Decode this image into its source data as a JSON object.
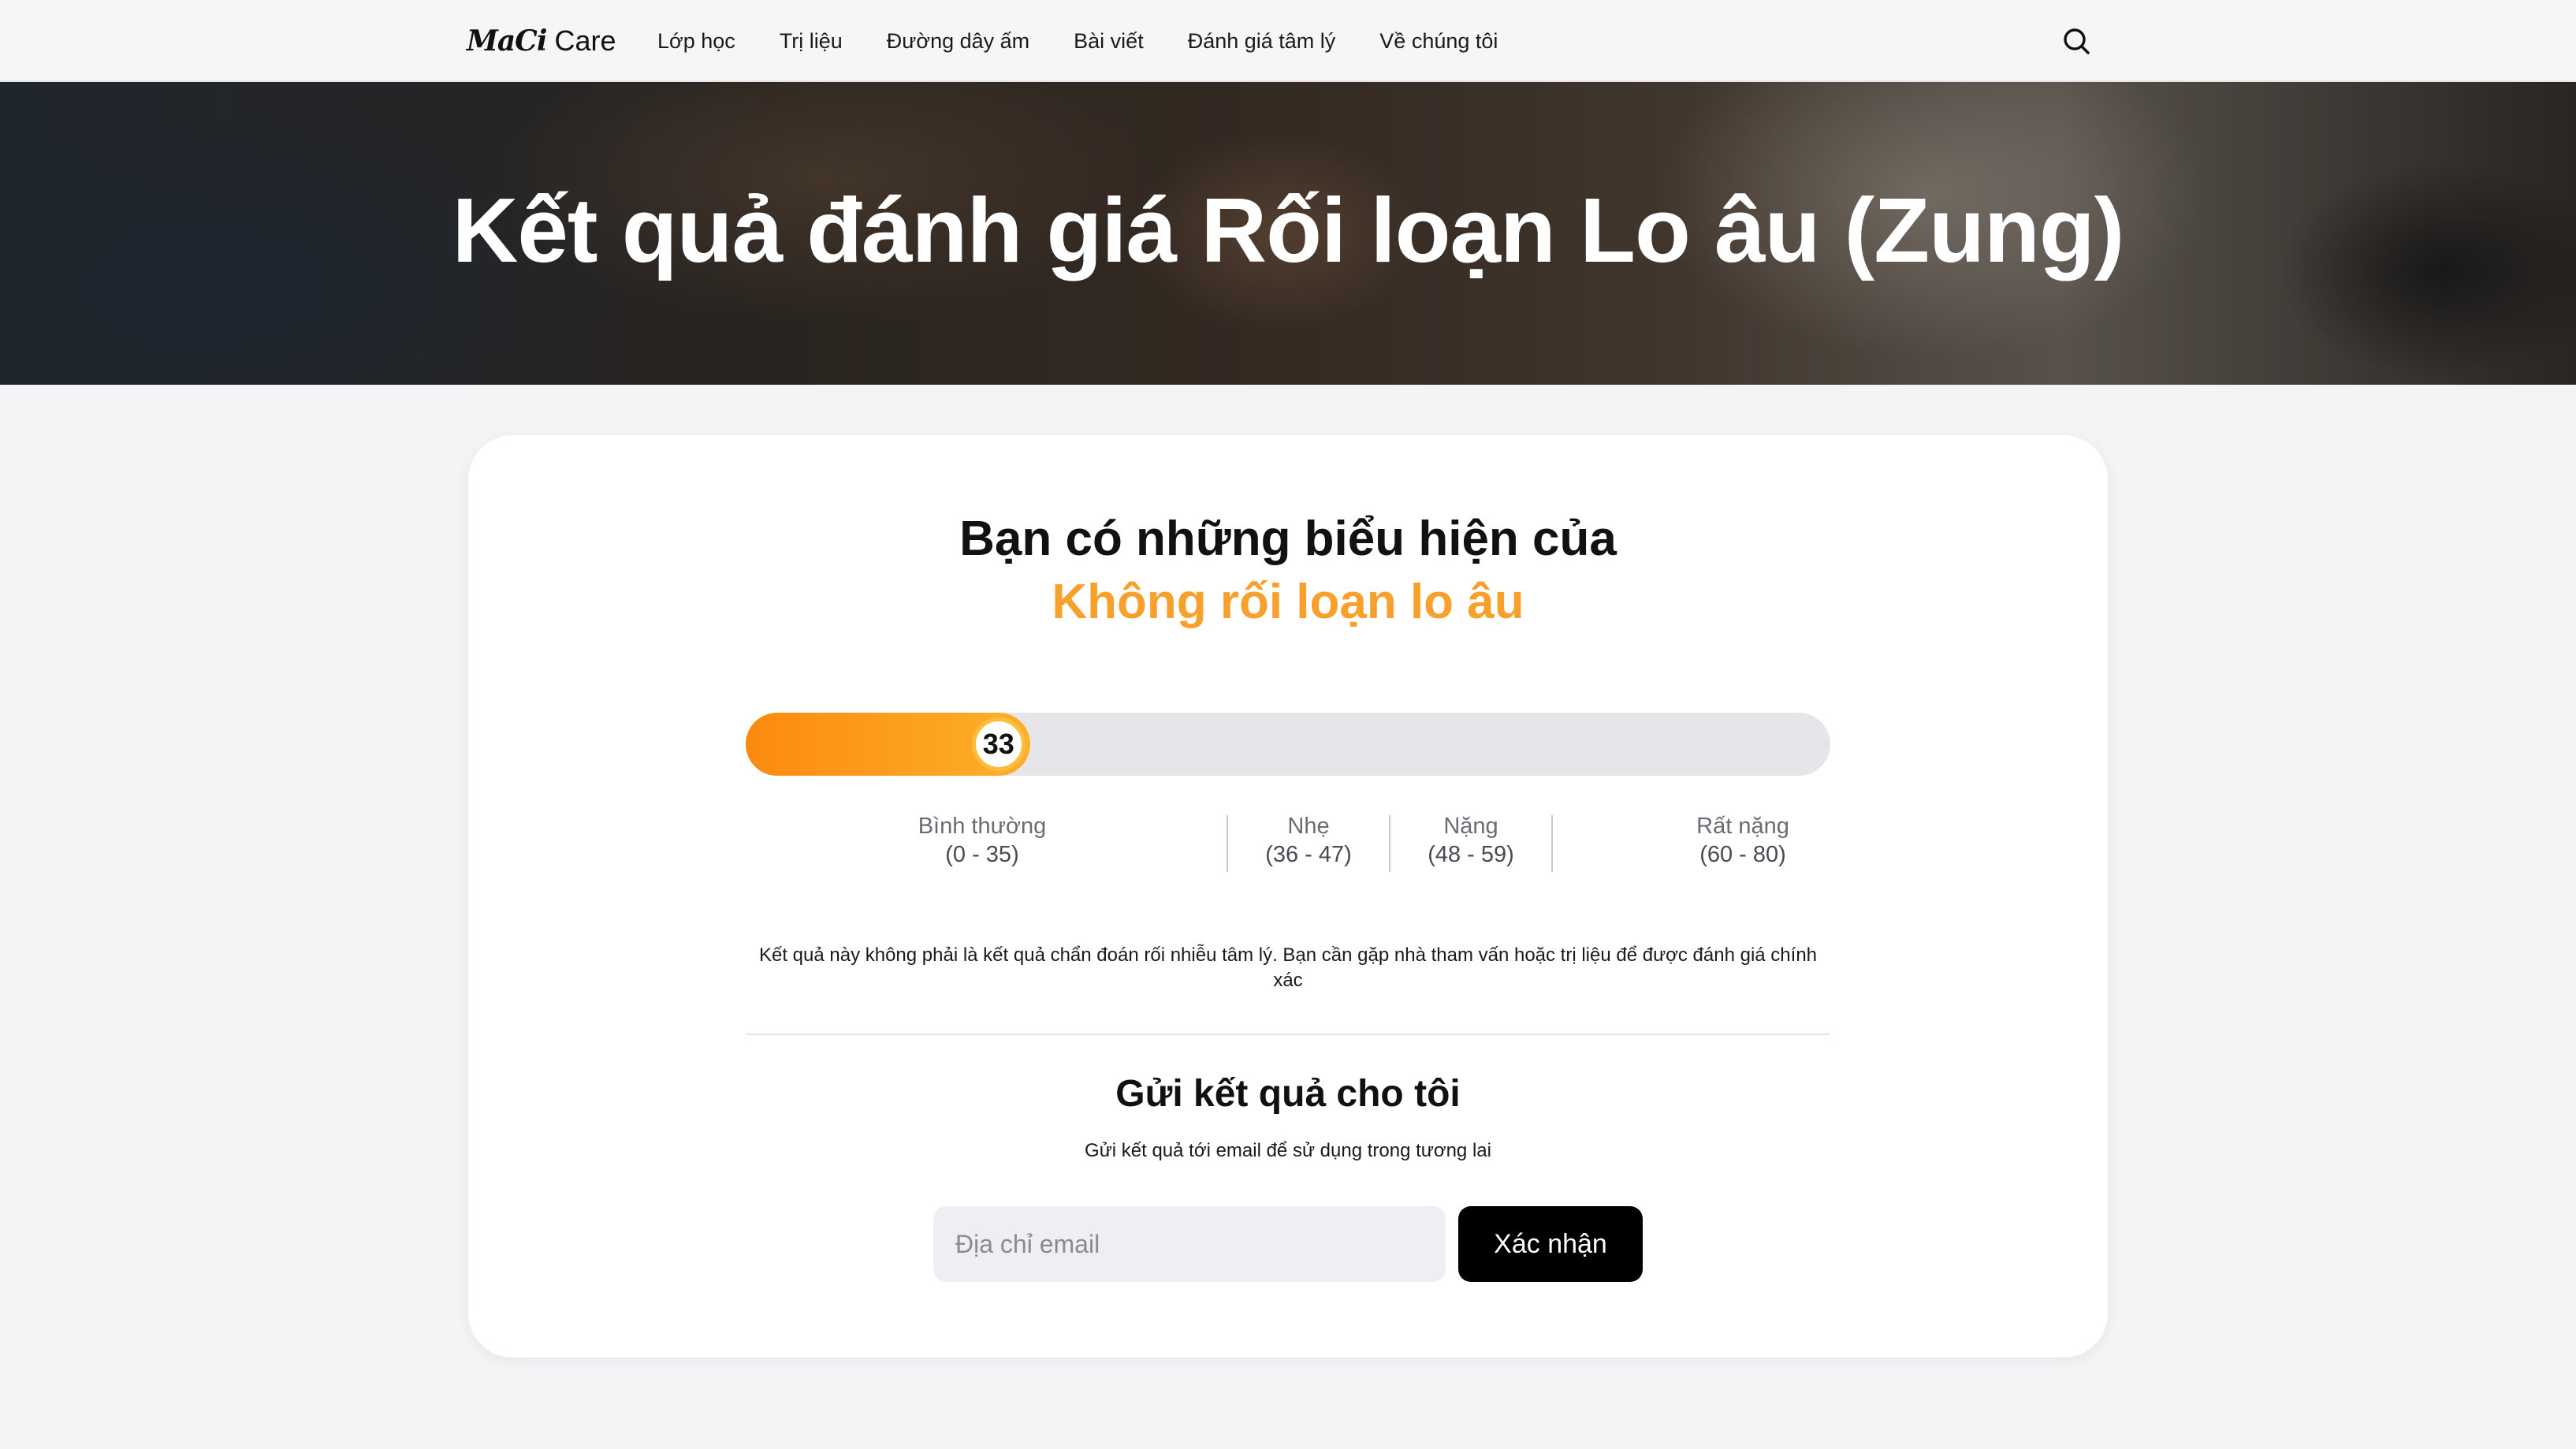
{
  "header": {
    "logo_mark": "MaCi",
    "logo_word": "Care",
    "nav": [
      {
        "label": "Lớp học"
      },
      {
        "label": "Trị liệu"
      },
      {
        "label": "Đường dây ấm"
      },
      {
        "label": "Bài viết"
      },
      {
        "label": "Đánh giá tâm lý"
      },
      {
        "label": "Về chúng tôi"
      }
    ],
    "search_icon": "search-icon"
  },
  "hero": {
    "title": "Kết quả đánh giá Rối loạn Lo âu (Zung)"
  },
  "result": {
    "heading": "Bạn có những biểu hiện của",
    "value": "Không rối loạn lo âu",
    "score": "33",
    "scale_min": 20,
    "scale_max": 80,
    "levels": [
      {
        "name": "Bình thường",
        "range": "(0 - 35)"
      },
      {
        "name": "Nhẹ",
        "range": "(36 - 47)"
      },
      {
        "name": "Nặng",
        "range": "(48 - 59)"
      },
      {
        "name": "Rất nặng",
        "range": "(60 - 80)"
      }
    ],
    "disclaimer": "Kết quả này không phải là kết quả chẩn đoán rối nhiễu tâm lý. Bạn cần gặp nhà tham vấn hoặc trị liệu để được đánh giá chính xác"
  },
  "send": {
    "title": "Gửi kết quả cho tôi",
    "subtitle": "Gửi kết quả tới email để sử dụng trong tương lai",
    "email_placeholder": "Địa chỉ email",
    "email_value": "",
    "confirm_label": "Xác nhận"
  },
  "colors": {
    "accent": "#f7a02c",
    "fill_start": "#fb8a10",
    "fill_end": "#fdb02a",
    "track": "#e6e6ea",
    "button": "#000000"
  }
}
